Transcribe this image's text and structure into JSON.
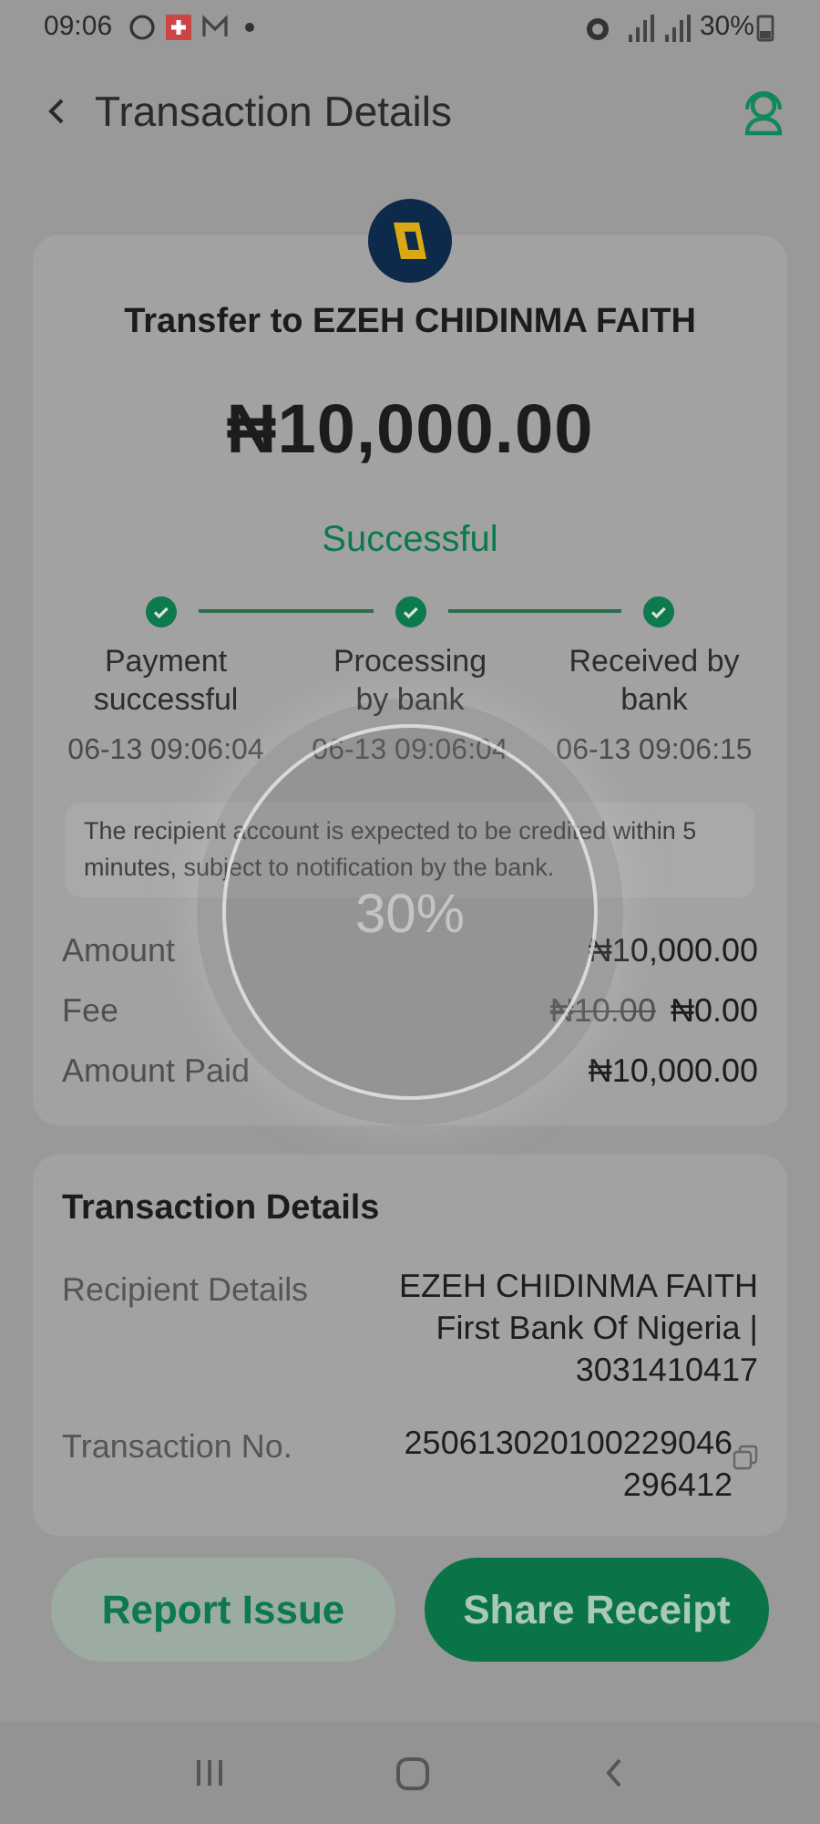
{
  "status_bar": {
    "time": "09:06",
    "battery": "30%"
  },
  "header": {
    "title": "Transaction Details"
  },
  "summary": {
    "title": "Transfer to EZEH CHIDINMA FAITH",
    "amount": "₦10,000.00",
    "status": "Successful",
    "steps": [
      {
        "label": "Payment successful",
        "time": "06-13 09:06:04",
        "done": true
      },
      {
        "label": "Processing by bank",
        "time": "06-13 09:06:04",
        "done": true
      },
      {
        "label": "Received by bank",
        "time": "06-13 09:06:15",
        "done": true
      }
    ],
    "notice": "The recipient account is expected to be credited within 5 minutes, subject to notification by the bank.",
    "rows": [
      {
        "label": "Amount",
        "value": "₦10,000.00"
      },
      {
        "label": "Fee",
        "old_value": "₦10.00",
        "value": "₦0.00"
      },
      {
        "label": "Amount Paid",
        "value": "₦10,000.00"
      }
    ]
  },
  "details": {
    "title": "Transaction Details",
    "rows": [
      {
        "label": "Recipient Details",
        "lines": [
          "EZEH CHIDINMA FAITH",
          "First Bank Of Nigeria |",
          "3031410417"
        ],
        "copy": false
      },
      {
        "label": "Transaction No.",
        "lines": [
          "250613020100229046",
          "296412"
        ],
        "copy": true
      }
    ]
  },
  "buttons": [
    {
      "label": "Report Issue",
      "kind": "secondary"
    },
    {
      "label": "Share Receipt",
      "kind": "primary"
    }
  ],
  "loader": {
    "text": "30%"
  }
}
